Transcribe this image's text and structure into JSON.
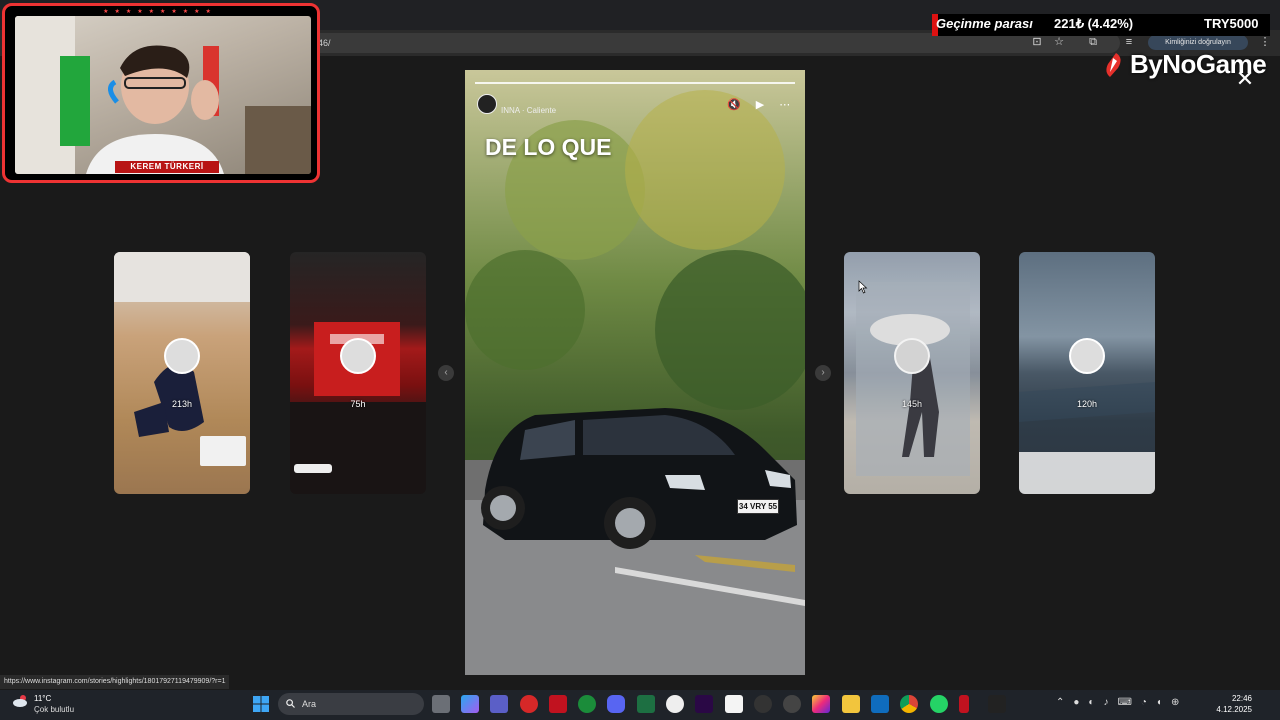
{
  "browser": {
    "url_fragment": "46/",
    "verify_label": "Kimliğinizi doğrulayın"
  },
  "webcam": {
    "streamer_name": "KEREM TÜRKERİ",
    "stars": "★★★★★★★★★★"
  },
  "ticker": {
    "label": "Geçinme parası",
    "value": "221₺ (4.42%)",
    "currency": "TRY5000"
  },
  "logo": {
    "text": "ByNoGame"
  },
  "stories": {
    "cards": [
      {
        "time": "213h"
      },
      {
        "time": "75h"
      },
      {
        "time": "145h"
      },
      {
        "time": "120h"
      }
    ],
    "main": {
      "song": "INNA · Caliente",
      "caption": "DE LO QUE",
      "plate": "34 VRY 55",
      "controls": "🔇 ▶ ⋯"
    },
    "close_label": "✕"
  },
  "status_url": "https://www.instagram.com/stories/highlights/18017927119479909/?r=1",
  "taskbar": {
    "weather_temp": "11°C",
    "weather_desc": "Çok bulutlu",
    "search_placeholder": "Ara",
    "time": "22:46",
    "date": "4.12.2025"
  },
  "colors": {
    "accent_red": "#e33333",
    "ticker_bg": "#000000",
    "page_bg": "#1a1a1a"
  }
}
